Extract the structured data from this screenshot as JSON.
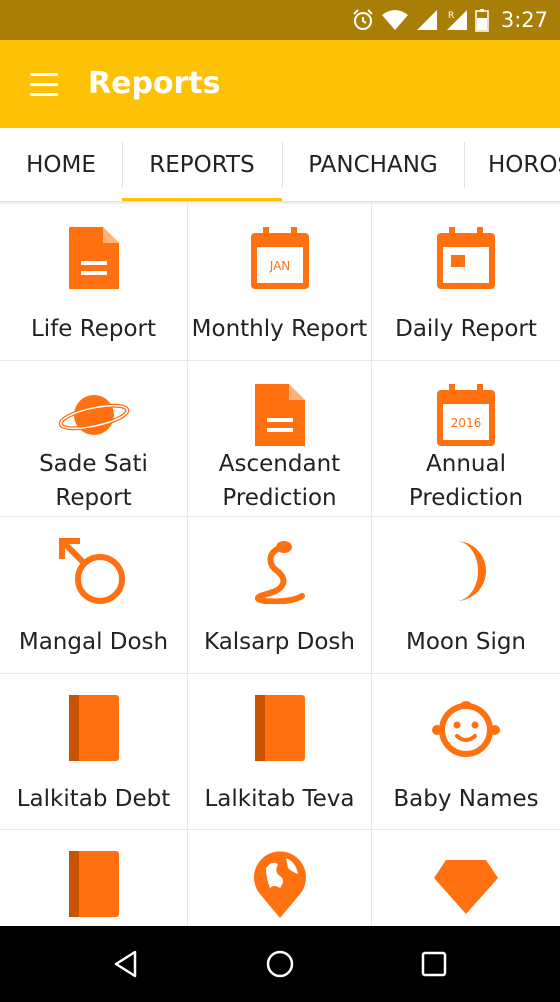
{
  "status_bar": {
    "time": "3:27",
    "icons": [
      "alarm-icon",
      "wifi-icon",
      "signal-icon",
      "roaming-signal-icon",
      "battery-icon"
    ]
  },
  "app_bar": {
    "title": "Reports",
    "menu_icon": "hamburger-menu-icon"
  },
  "tabs": [
    {
      "label": "HOME"
    },
    {
      "label": "REPORTS",
      "selected": true
    },
    {
      "label": "PANCHANG"
    },
    {
      "label": "HOROS"
    }
  ],
  "grid": {
    "rows": [
      [
        {
          "label_lines": [
            "Life Report"
          ],
          "icon": "document-icon"
        },
        {
          "label_lines": [
            "Monthly Report"
          ],
          "icon": "calendar-jan-icon",
          "icon_text": "JAN"
        },
        {
          "label_lines": [
            "Daily Report"
          ],
          "icon": "calendar-day-icon"
        }
      ],
      [
        {
          "label_lines": [
            "Sade Sati",
            "Report"
          ],
          "icon": "saturn-icon"
        },
        {
          "label_lines": [
            "Ascendant",
            "Prediction"
          ],
          "icon": "document-icon"
        },
        {
          "label_lines": [
            "Annual",
            "Prediction"
          ],
          "icon": "calendar-year-icon",
          "icon_text": "2016"
        }
      ],
      [
        {
          "label_lines": [
            "Mangal Dosh"
          ],
          "icon": "mars-symbol-icon"
        },
        {
          "label_lines": [
            "Kalsarp Dosh"
          ],
          "icon": "snake-icon"
        },
        {
          "label_lines": [
            "Moon Sign"
          ],
          "icon": "crescent-moon-icon"
        }
      ],
      [
        {
          "label_lines": [
            "Lalkitab Debt"
          ],
          "icon": "book-icon"
        },
        {
          "label_lines": [
            "Lalkitab Teva"
          ],
          "icon": "book-icon"
        },
        {
          "label_lines": [
            "Baby Names"
          ],
          "icon": "baby-face-icon"
        }
      ],
      [
        {
          "label_lines": [],
          "icon": "book-icon"
        },
        {
          "label_lines": [],
          "icon": "globe-pin-icon"
        },
        {
          "label_lines": [],
          "icon": "gem-icon"
        }
      ]
    ]
  },
  "nav_bar": {
    "buttons": [
      "back-icon",
      "home-circle-icon",
      "recents-square-icon"
    ]
  },
  "colors": {
    "accent": "#FDC106",
    "status_bar": "#A87E06",
    "icon_orange": "#FF7011",
    "text": "#222222",
    "nav_bar": "#000000"
  }
}
